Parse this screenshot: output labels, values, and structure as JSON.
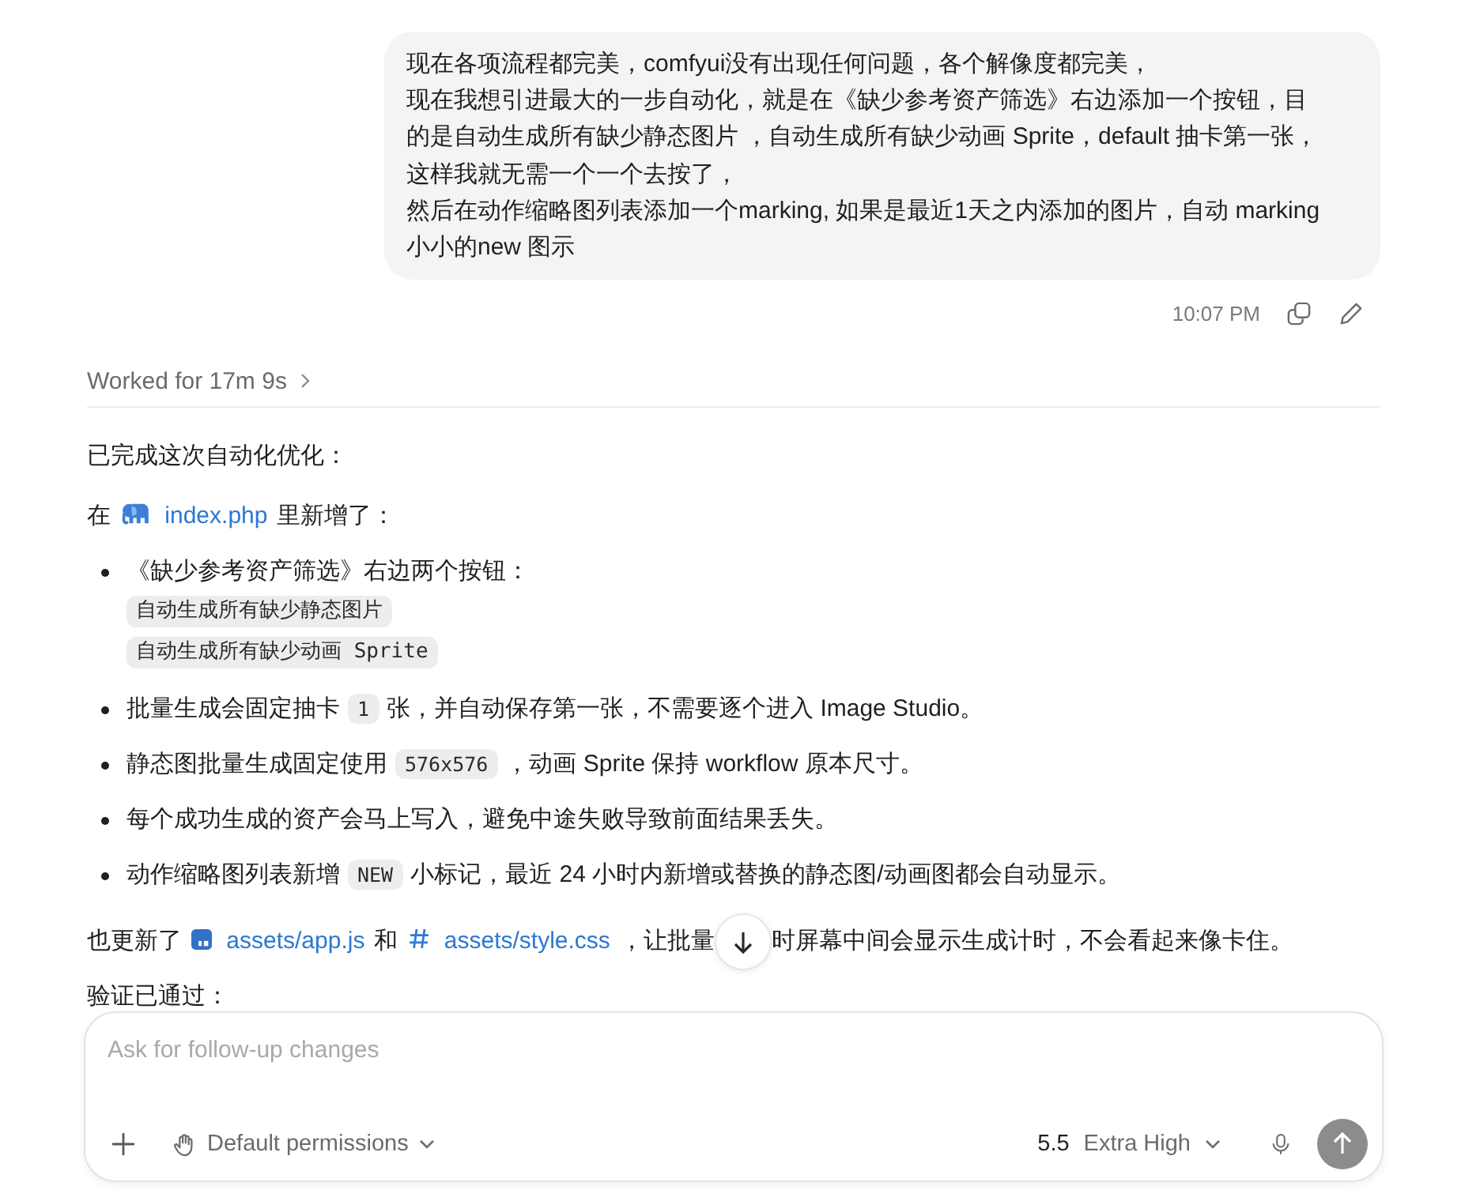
{
  "user_message": {
    "lines": [
      "现在各项流程都完美，comfyui没有出现任何问题，各个解像度都完美，",
      "现在我想引进最大的一步自动化，就是在《缺少参考资产筛选》右边添加一个按钮，目",
      "的是自动生成所有缺少静态图片 ，自动生成所有缺少动画 Sprite，default 抽卡第一张，",
      "这样我就无需一个一个去按了，",
      "然后在动作缩略图列表添加一个marking, 如果是最近1天之内添加的图片，自动 marking",
      "小小的new 图示"
    ],
    "time": "10:07 PM"
  },
  "work_summary": {
    "label": "Worked for 17m 9s",
    "expanded": false
  },
  "response": [
    {
      "kind": "paragraph",
      "parts": [
        {
          "kind": "text",
          "text": "已完成这次自动化优化："
        }
      ]
    },
    {
      "kind": "paragraph",
      "parts": [
        {
          "kind": "text",
          "text": "在"
        },
        {
          "kind": "php_link",
          "text": "index.php"
        },
        {
          "kind": "text",
          "text": "里新增了："
        }
      ]
    },
    {
      "kind": "list",
      "items": [
        {
          "parts": [
            {
              "kind": "text",
              "text": "《缺少参考资产筛选》右边两个按钮："
            }
          ],
          "code_lines": [
            "自动生成所有缺少静态图片",
            "自动生成所有缺少动画 Sprite"
          ]
        },
        {
          "parts": [
            {
              "kind": "text",
              "text": "批量生成会固定抽卡"
            },
            {
              "kind": "code",
              "text": "1"
            },
            {
              "kind": "text",
              "text": "张，并自动保存第一张，不需要逐个进入 Image Studio。"
            }
          ]
        },
        {
          "parts": [
            {
              "kind": "text",
              "text": "静态图批量生成固定使用"
            },
            {
              "kind": "code",
              "text": "576x576"
            },
            {
              "kind": "text",
              "text": "，动画 Sprite 保持 workflow 原本尺寸。"
            }
          ]
        },
        {
          "parts": [
            {
              "kind": "text",
              "text": "每个成功生成的资产会马上写入，避免中途失败导致前面结果丢失。"
            }
          ]
        },
        {
          "parts": [
            {
              "kind": "text",
              "text": "动作缩略图列表新增"
            },
            {
              "kind": "code",
              "text": "NEW"
            },
            {
              "kind": "text",
              "text": "小标记，最近 24 小时内新增或替换的静态图/动画图都会自动显示。"
            }
          ]
        }
      ]
    },
    {
      "kind": "paragraph",
      "parts": [
        {
          "kind": "text",
          "text": "也更新了"
        },
        {
          "kind": "js_link",
          "text": "assets/app.js"
        },
        {
          "kind": "text",
          "text": "和"
        },
        {
          "kind": "css_link",
          "text": "assets/style.css"
        },
        {
          "kind": "text",
          "text": "，让批量"
        },
        {
          "kind": "scroll_button"
        },
        {
          "kind": "text",
          "text": "时屏幕中间会显示生成计时，不会看起来像卡住。"
        }
      ]
    },
    {
      "kind": "paragraph",
      "parts": [
        {
          "kind": "text",
          "text": "验证已通过："
        }
      ]
    }
  ],
  "composer": {
    "placeholder": "Ask for follow-up changes",
    "permissions": "Default permissions",
    "model": "5.5",
    "effort": "Extra High"
  }
}
